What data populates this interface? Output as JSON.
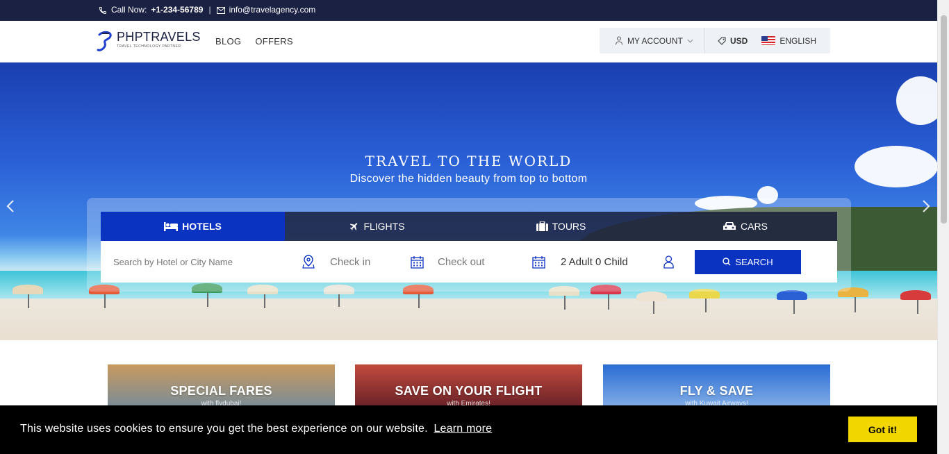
{
  "topbar": {
    "call_label": "Call Now:",
    "phone": "+1-234-56789",
    "separator": "|",
    "email": "info@travelagency.com"
  },
  "header": {
    "logo_text": "PHPTRAVELS",
    "logo_tagline": "TRAVEL TECHNOLOGY PARTNER",
    "nav": [
      "BLOG",
      "OFFERS"
    ],
    "account": "MY ACCOUNT",
    "currency": "USD",
    "language": "ENGLISH"
  },
  "hero": {
    "title": "TRAVEL TO THE WORLD",
    "subtitle": "Discover the hidden beauty from top to bottom"
  },
  "search": {
    "tabs": [
      {
        "label": "HOTELS",
        "icon": "bed-icon",
        "active": true
      },
      {
        "label": "FLIGHTS",
        "icon": "plane-icon",
        "active": false
      },
      {
        "label": "TOURS",
        "icon": "suitcase-icon",
        "active": false
      },
      {
        "label": "CARS",
        "icon": "car-icon",
        "active": false
      }
    ],
    "hotel_placeholder": "Search by Hotel or City Name",
    "checkin_placeholder": "Check in",
    "checkout_placeholder": "Check out",
    "guests": "2 Adult 0 Child",
    "button": "SEARCH"
  },
  "promos": [
    {
      "title": "SPECIAL FARES",
      "subtitle": "with flydubai!"
    },
    {
      "title": "SAVE ON YOUR FLIGHT",
      "subtitle": "with Emirates!"
    },
    {
      "title": "FLY & SAVE",
      "subtitle": "with Kuwait Airways!"
    }
  ],
  "cookie": {
    "message": "This website uses cookies to ensure you get the best experience on our website.",
    "learn_more": "Learn more",
    "button": "Got it!"
  },
  "colors": {
    "topbar": "#1b2142",
    "accent": "#0a33c2",
    "cookie_button": "#f1d600"
  }
}
